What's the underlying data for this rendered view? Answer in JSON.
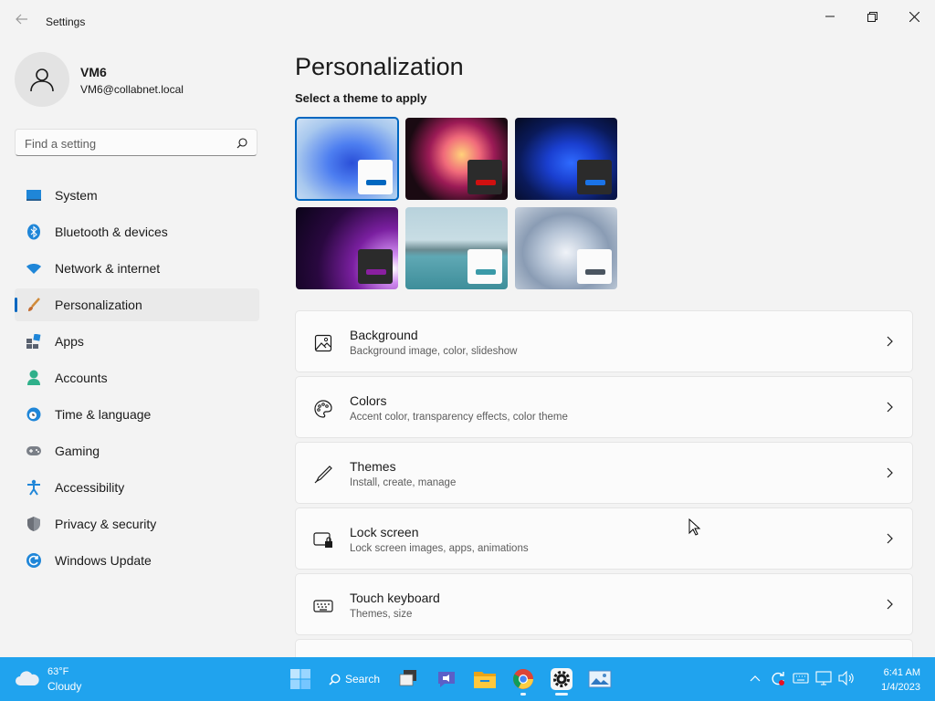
{
  "window": {
    "title": "Settings",
    "back_icon": "back-arrow-icon",
    "controls": [
      "minimize-icon",
      "restore-icon",
      "close-icon"
    ]
  },
  "user": {
    "name": "VM6",
    "email": "VM6@collabnet.local"
  },
  "search": {
    "placeholder": "Find a setting"
  },
  "sidebar": {
    "items": [
      {
        "label": "System",
        "icon": "system-icon",
        "selected": false
      },
      {
        "label": "Bluetooth & devices",
        "icon": "bluetooth-icon",
        "selected": false
      },
      {
        "label": "Network & internet",
        "icon": "wifi-icon",
        "selected": false
      },
      {
        "label": "Personalization",
        "icon": "brush-icon",
        "selected": true
      },
      {
        "label": "Apps",
        "icon": "apps-icon",
        "selected": false
      },
      {
        "label": "Accounts",
        "icon": "accounts-icon",
        "selected": false
      },
      {
        "label": "Time & language",
        "icon": "time-language-icon",
        "selected": false
      },
      {
        "label": "Gaming",
        "icon": "gamepad-icon",
        "selected": false
      },
      {
        "label": "Accessibility",
        "icon": "accessibility-icon",
        "selected": false
      },
      {
        "label": "Privacy & security",
        "icon": "shield-icon",
        "selected": false
      },
      {
        "label": "Windows Update",
        "icon": "windows-update-icon",
        "selected": false
      }
    ]
  },
  "main": {
    "title": "Personalization",
    "themes_heading": "Select a theme to apply",
    "themes": [
      {
        "name": "windows-light",
        "selected": true,
        "accent": "#0067c0"
      },
      {
        "name": "glow",
        "selected": false,
        "accent": "#d01010"
      },
      {
        "name": "windows-dark",
        "selected": false,
        "accent": "#1a73e8"
      },
      {
        "name": "captured-motion",
        "selected": false,
        "accent": "#8a1fa0"
      },
      {
        "name": "sunrise",
        "selected": false,
        "accent": "#3a9aa8"
      },
      {
        "name": "flow",
        "selected": false,
        "accent": "#4a5560"
      }
    ],
    "cards": [
      {
        "title": "Background",
        "subtitle": "Background image, color, slideshow",
        "icon": "image-icon"
      },
      {
        "title": "Colors",
        "subtitle": "Accent color, transparency effects, color theme",
        "icon": "palette-icon"
      },
      {
        "title": "Themes",
        "subtitle": "Install, create, manage",
        "icon": "pen-icon"
      },
      {
        "title": "Lock screen",
        "subtitle": "Lock screen images, apps, animations",
        "icon": "lock-screen-icon"
      },
      {
        "title": "Touch keyboard",
        "subtitle": "Themes, size",
        "icon": "keyboard-icon"
      }
    ]
  },
  "taskbar": {
    "weather": {
      "temp": "63°F",
      "condition": "Cloudy",
      "icon": "cloud-icon"
    },
    "search_label": "Search",
    "apps": [
      "start-icon",
      "task-view-icon",
      "teams-chat-icon",
      "file-explorer-icon",
      "chrome-icon",
      "settings-gear-icon",
      "photos-icon"
    ],
    "tray": [
      "chevron-up-icon",
      "sync-icon",
      "keyboard-tray-icon",
      "display-icon",
      "volume-icon"
    ],
    "time": "6:41 AM",
    "date": "1/4/2023"
  },
  "colors": {
    "accent": "#0067c0",
    "taskbar": "#20a3ee"
  }
}
